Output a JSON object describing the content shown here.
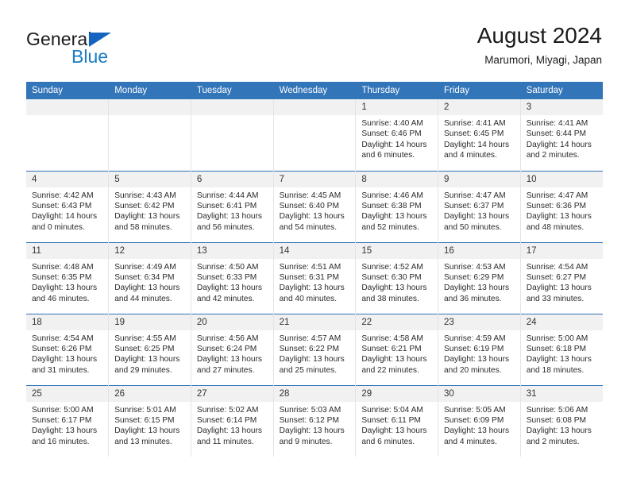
{
  "brand": {
    "name_part1": "General",
    "name_part2": "Blue",
    "triangle_color": "#1565c0",
    "blue_color": "#1a7bc4"
  },
  "header": {
    "title": "August 2024",
    "subtitle": "Marumori, Miyagi, Japan"
  },
  "theme": {
    "header_blue": "#3275b9",
    "daynum_band": "#f1f1f1",
    "cell_border": "#e4e4e4"
  },
  "weekdays": [
    "Sunday",
    "Monday",
    "Tuesday",
    "Wednesday",
    "Thursday",
    "Friday",
    "Saturday"
  ],
  "weeks": [
    [
      {
        "day": "",
        "empty": true
      },
      {
        "day": "",
        "empty": true
      },
      {
        "day": "",
        "empty": true
      },
      {
        "day": "",
        "empty": true
      },
      {
        "day": "1",
        "sunrise": "Sunrise: 4:40 AM",
        "sunset": "Sunset: 6:46 PM",
        "daylight": "Daylight: 14 hours and 6 minutes."
      },
      {
        "day": "2",
        "sunrise": "Sunrise: 4:41 AM",
        "sunset": "Sunset: 6:45 PM",
        "daylight": "Daylight: 14 hours and 4 minutes."
      },
      {
        "day": "3",
        "sunrise": "Sunrise: 4:41 AM",
        "sunset": "Sunset: 6:44 PM",
        "daylight": "Daylight: 14 hours and 2 minutes."
      }
    ],
    [
      {
        "day": "4",
        "sunrise": "Sunrise: 4:42 AM",
        "sunset": "Sunset: 6:43 PM",
        "daylight": "Daylight: 14 hours and 0 minutes."
      },
      {
        "day": "5",
        "sunrise": "Sunrise: 4:43 AM",
        "sunset": "Sunset: 6:42 PM",
        "daylight": "Daylight: 13 hours and 58 minutes."
      },
      {
        "day": "6",
        "sunrise": "Sunrise: 4:44 AM",
        "sunset": "Sunset: 6:41 PM",
        "daylight": "Daylight: 13 hours and 56 minutes."
      },
      {
        "day": "7",
        "sunrise": "Sunrise: 4:45 AM",
        "sunset": "Sunset: 6:40 PM",
        "daylight": "Daylight: 13 hours and 54 minutes."
      },
      {
        "day": "8",
        "sunrise": "Sunrise: 4:46 AM",
        "sunset": "Sunset: 6:38 PM",
        "daylight": "Daylight: 13 hours and 52 minutes."
      },
      {
        "day": "9",
        "sunrise": "Sunrise: 4:47 AM",
        "sunset": "Sunset: 6:37 PM",
        "daylight": "Daylight: 13 hours and 50 minutes."
      },
      {
        "day": "10",
        "sunrise": "Sunrise: 4:47 AM",
        "sunset": "Sunset: 6:36 PM",
        "daylight": "Daylight: 13 hours and 48 minutes."
      }
    ],
    [
      {
        "day": "11",
        "sunrise": "Sunrise: 4:48 AM",
        "sunset": "Sunset: 6:35 PM",
        "daylight": "Daylight: 13 hours and 46 minutes."
      },
      {
        "day": "12",
        "sunrise": "Sunrise: 4:49 AM",
        "sunset": "Sunset: 6:34 PM",
        "daylight": "Daylight: 13 hours and 44 minutes."
      },
      {
        "day": "13",
        "sunrise": "Sunrise: 4:50 AM",
        "sunset": "Sunset: 6:33 PM",
        "daylight": "Daylight: 13 hours and 42 minutes."
      },
      {
        "day": "14",
        "sunrise": "Sunrise: 4:51 AM",
        "sunset": "Sunset: 6:31 PM",
        "daylight": "Daylight: 13 hours and 40 minutes."
      },
      {
        "day": "15",
        "sunrise": "Sunrise: 4:52 AM",
        "sunset": "Sunset: 6:30 PM",
        "daylight": "Daylight: 13 hours and 38 minutes."
      },
      {
        "day": "16",
        "sunrise": "Sunrise: 4:53 AM",
        "sunset": "Sunset: 6:29 PM",
        "daylight": "Daylight: 13 hours and 36 minutes."
      },
      {
        "day": "17",
        "sunrise": "Sunrise: 4:54 AM",
        "sunset": "Sunset: 6:27 PM",
        "daylight": "Daylight: 13 hours and 33 minutes."
      }
    ],
    [
      {
        "day": "18",
        "sunrise": "Sunrise: 4:54 AM",
        "sunset": "Sunset: 6:26 PM",
        "daylight": "Daylight: 13 hours and 31 minutes."
      },
      {
        "day": "19",
        "sunrise": "Sunrise: 4:55 AM",
        "sunset": "Sunset: 6:25 PM",
        "daylight": "Daylight: 13 hours and 29 minutes."
      },
      {
        "day": "20",
        "sunrise": "Sunrise: 4:56 AM",
        "sunset": "Sunset: 6:24 PM",
        "daylight": "Daylight: 13 hours and 27 minutes."
      },
      {
        "day": "21",
        "sunrise": "Sunrise: 4:57 AM",
        "sunset": "Sunset: 6:22 PM",
        "daylight": "Daylight: 13 hours and 25 minutes."
      },
      {
        "day": "22",
        "sunrise": "Sunrise: 4:58 AM",
        "sunset": "Sunset: 6:21 PM",
        "daylight": "Daylight: 13 hours and 22 minutes."
      },
      {
        "day": "23",
        "sunrise": "Sunrise: 4:59 AM",
        "sunset": "Sunset: 6:19 PM",
        "daylight": "Daylight: 13 hours and 20 minutes."
      },
      {
        "day": "24",
        "sunrise": "Sunrise: 5:00 AM",
        "sunset": "Sunset: 6:18 PM",
        "daylight": "Daylight: 13 hours and 18 minutes."
      }
    ],
    [
      {
        "day": "25",
        "sunrise": "Sunrise: 5:00 AM",
        "sunset": "Sunset: 6:17 PM",
        "daylight": "Daylight: 13 hours and 16 minutes."
      },
      {
        "day": "26",
        "sunrise": "Sunrise: 5:01 AM",
        "sunset": "Sunset: 6:15 PM",
        "daylight": "Daylight: 13 hours and 13 minutes."
      },
      {
        "day": "27",
        "sunrise": "Sunrise: 5:02 AM",
        "sunset": "Sunset: 6:14 PM",
        "daylight": "Daylight: 13 hours and 11 minutes."
      },
      {
        "day": "28",
        "sunrise": "Sunrise: 5:03 AM",
        "sunset": "Sunset: 6:12 PM",
        "daylight": "Daylight: 13 hours and 9 minutes."
      },
      {
        "day": "29",
        "sunrise": "Sunrise: 5:04 AM",
        "sunset": "Sunset: 6:11 PM",
        "daylight": "Daylight: 13 hours and 6 minutes."
      },
      {
        "day": "30",
        "sunrise": "Sunrise: 5:05 AM",
        "sunset": "Sunset: 6:09 PM",
        "daylight": "Daylight: 13 hours and 4 minutes."
      },
      {
        "day": "31",
        "sunrise": "Sunrise: 5:06 AM",
        "sunset": "Sunset: 6:08 PM",
        "daylight": "Daylight: 13 hours and 2 minutes."
      }
    ]
  ]
}
